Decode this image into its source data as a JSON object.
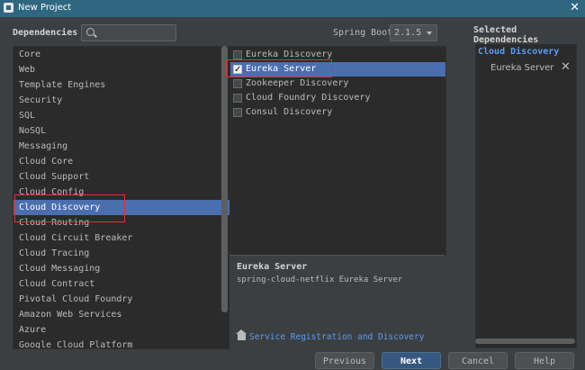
{
  "window": {
    "title": "New Project"
  },
  "dependencies_header": {
    "label": "Dependencies",
    "search_value": "",
    "search_placeholder": ""
  },
  "spring_boot": {
    "label": "Spring Boot",
    "version": "2.1.5"
  },
  "categories": {
    "selected": "Cloud Discovery",
    "items": [
      {
        "label": "Core"
      },
      {
        "label": "Web"
      },
      {
        "label": "Template Engines"
      },
      {
        "label": "Security"
      },
      {
        "label": "SQL"
      },
      {
        "label": "NoSQL"
      },
      {
        "label": "Messaging"
      },
      {
        "label": "Cloud Core"
      },
      {
        "label": "Cloud Support"
      },
      {
        "label": "Cloud Config"
      },
      {
        "label": "Cloud Discovery"
      },
      {
        "label": "Cloud Routing"
      },
      {
        "label": "Cloud Circuit Breaker"
      },
      {
        "label": "Cloud Tracing"
      },
      {
        "label": "Cloud Messaging"
      },
      {
        "label": "Cloud Contract"
      },
      {
        "label": "Pivotal Cloud Foundry"
      },
      {
        "label": "Amazon Web Services"
      },
      {
        "label": "Azure"
      },
      {
        "label": "Google Cloud Platform"
      }
    ]
  },
  "dependencies": {
    "items": [
      {
        "label": "Eureka Discovery",
        "checked": false
      },
      {
        "label": "Eureka Server",
        "checked": true
      },
      {
        "label": "Zookeeper Discovery",
        "checked": false
      },
      {
        "label": "Cloud Foundry Discovery",
        "checked": false
      },
      {
        "label": "Consul Discovery",
        "checked": false
      }
    ]
  },
  "description": {
    "title": "Eureka Server",
    "text": "spring-cloud-netflix Eureka Server",
    "link": "Service Registration and Discovery"
  },
  "selected_dependencies": {
    "title": "Selected Dependencies",
    "group": "Cloud Discovery",
    "item": "Eureka Server"
  },
  "buttons": {
    "previous": "Previous",
    "next": "Next",
    "cancel": "Cancel",
    "help": "Help"
  },
  "icons": {
    "close": "close-icon",
    "search": "search-icon",
    "home": "home-icon",
    "remove": "remove-icon"
  },
  "colors": {
    "titlebar": "#2f6780",
    "selection": "#4b6eaf",
    "link": "#589df6",
    "highlight_border": "#e5303a"
  }
}
